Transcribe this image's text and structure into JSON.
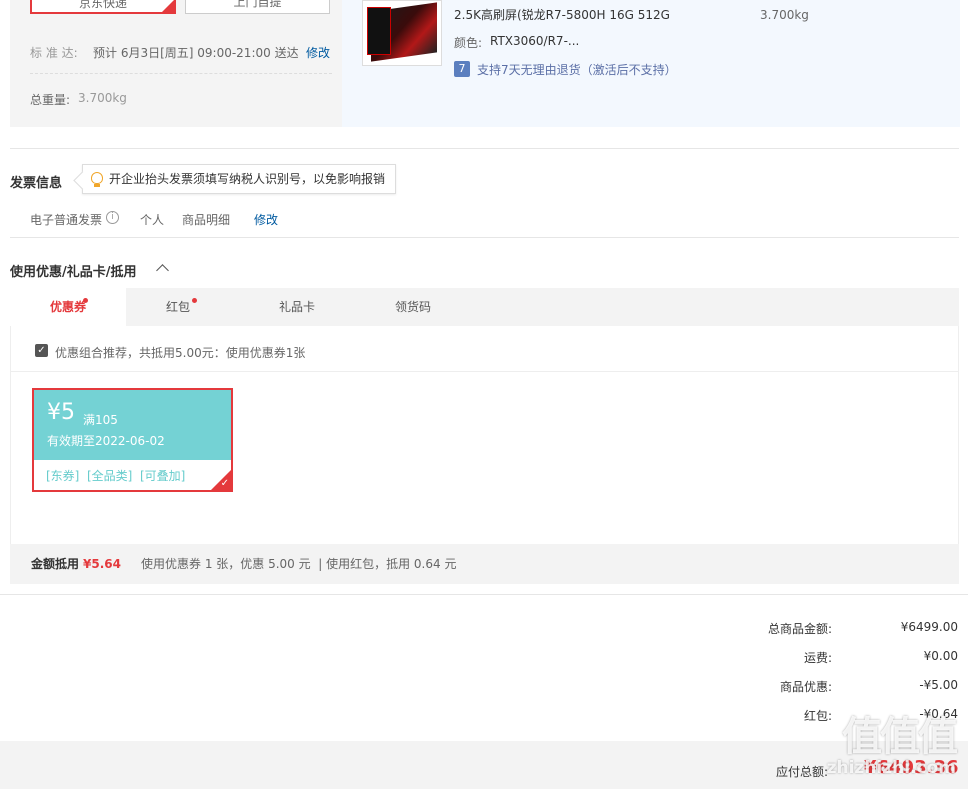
{
  "shipping": {
    "jd_option": "京东快递",
    "pickup_option": "上门自提",
    "standard_label": "标 准 达:",
    "standard_time": "预计 6月3日[周五] 09:00-21:00 送达",
    "modify": "修改",
    "total_weight_label": "总重量:",
    "total_weight_value": "3.700kg"
  },
  "product": {
    "spec": "2.5K高刷屏(锐龙R7-5800H 16G 512G",
    "color_label": "颜色:",
    "color_value": "RTX3060/R7-...",
    "return_icon_text": "7",
    "return_policy": "支持7天无理由退货（激活后不支持）",
    "weight": "3.700kg"
  },
  "invoice": {
    "title": "发票信息",
    "tip": "开企业抬头发票须填写纳税人识别号，以免影响报销",
    "type": "电子普通发票",
    "holder": "个人",
    "content": "商品明细",
    "modify": "修改"
  },
  "discount": {
    "title": "使用优惠/礼品卡/抵用",
    "tabs": [
      {
        "label": "优惠券",
        "dot": true
      },
      {
        "label": "红包",
        "dot": true
      },
      {
        "label": "礼品卡",
        "dot": false
      },
      {
        "label": "领货码",
        "dot": false
      }
    ],
    "combo_text": "优惠组合推荐，共抵用5.00元：使用优惠券1张",
    "coupon": {
      "amount": "¥5",
      "condition": "满105",
      "validity": "有效期至2022-06-02",
      "tags": "[东券]  [全品类]  [可叠加]"
    },
    "summary_label": "金额抵用",
    "summary_amount": "¥5.64",
    "summary_detail": "使用优惠券 1 张，优惠 5.00 元  | 使用红包，抵用 0.64 元"
  },
  "totals": {
    "goods_label": "总商品金额:",
    "goods_value": "¥6499.00",
    "shipping_label": "运费:",
    "shipping_value": "¥0.00",
    "discount_label": "商品优惠:",
    "discount_value": "-¥5.00",
    "redpacket_label": "红包:",
    "redpacket_value": "-¥0.64",
    "payable_label": "应付总额:",
    "payable_value": "¥6493.36"
  },
  "watermark": {
    "logo": "值值值",
    "site": "zhizhizhi.com"
  },
  "colors": {
    "accent": "#e4393c",
    "link": "#005aa0",
    "coupon": "#74d2d4"
  }
}
